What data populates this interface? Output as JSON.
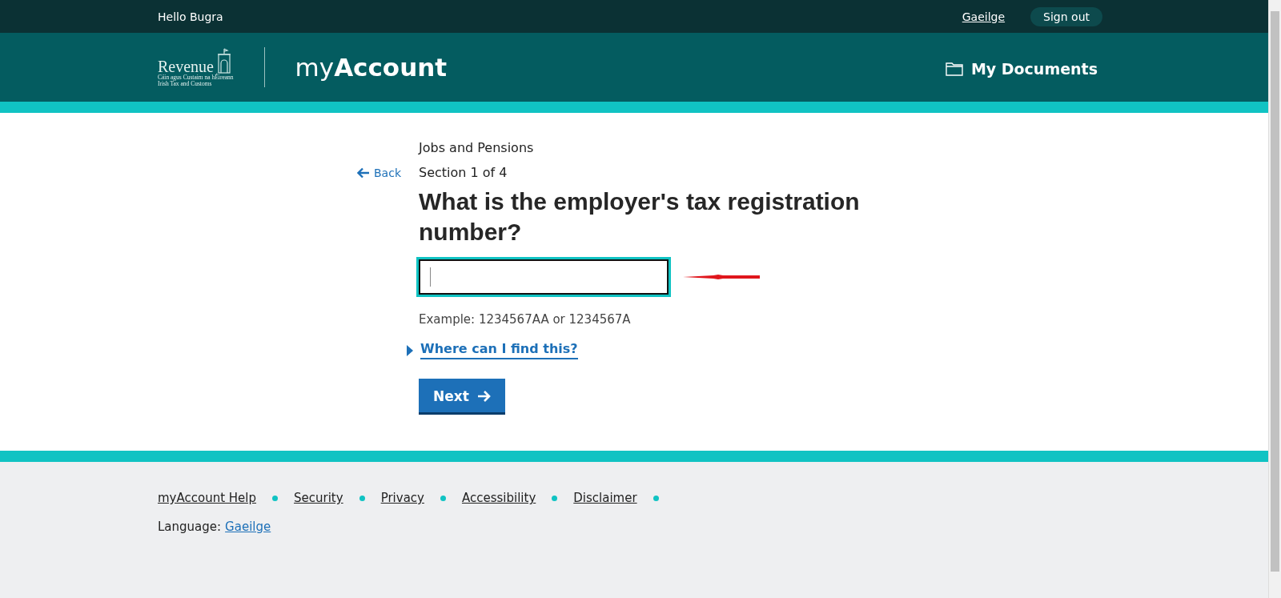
{
  "top_bar": {
    "greeting": "Hello Bugra",
    "language_link": "Gaeilge",
    "sign_out": "Sign out"
  },
  "header": {
    "logo": {
      "name": "Revenue",
      "line_1": "Cáin agus Custaim na hÉireann",
      "line_2": "Irish Tax and Customs"
    },
    "product": "my**Account**",
    "documents_link": "My Documents"
  },
  "form": {
    "back": "Back",
    "caption": "Jobs and Pensions",
    "section": "Section 1 of 4",
    "question": "What is the employer's tax registration number?",
    "hint": "Example: 1234567AA or 1234567A",
    "details": {
      "label": "Where can I find this?",
      "expanded": false
    },
    "next_button": "Next"
  },
  "footer": {
    "links": [
      "myAccount Help",
      "Security",
      "Privacy",
      "Accessibility",
      "Disclaimer"
    ],
    "language_label": "Language:",
    "language_link": "Gaeilge"
  }
}
